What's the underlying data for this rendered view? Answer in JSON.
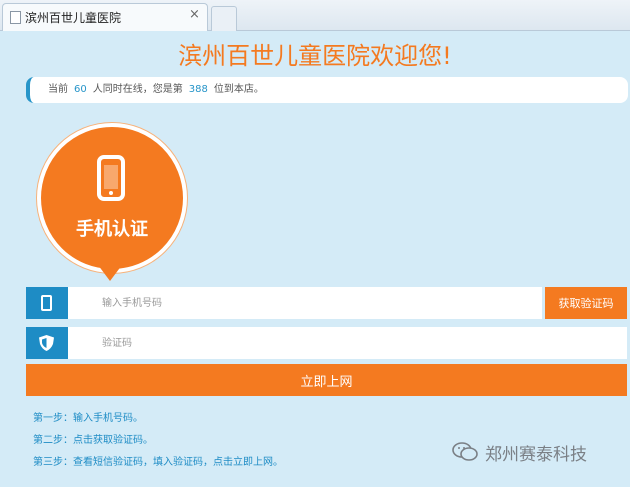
{
  "browser": {
    "tab_title": "滨州百世儿童医院",
    "tab_close": "×",
    "page_icon": "page-icon",
    "tab_close_icon": "close-icon"
  },
  "page": {
    "welcome": "滨州百世儿童医院欢迎您!",
    "online": {
      "prefix": "当前",
      "count": "60",
      "middle": "人同时在线，您是第",
      "rank": "388",
      "suffix": "位到本店。"
    },
    "auth_badge": {
      "label": "手机认证",
      "icon": "mobile-phone-icon"
    },
    "phone_field": {
      "placeholder": "输入手机号码",
      "icon": "mobile-phone-icon"
    },
    "get_code_button": "获取验证码",
    "code_field": {
      "placeholder": "验证码",
      "icon": "shield-icon"
    },
    "submit_button": "立即上网",
    "steps": [
      "第一步：输入手机号码。",
      "第二步：点击获取验证码。",
      "第三步：查看短信验证码，填入验证码，点击立即上网。"
    ],
    "watermark": {
      "text": "郑州赛泰科技",
      "icon": "wechat-icon"
    }
  },
  "colors": {
    "accent_orange": "#f47a20",
    "accent_blue": "#1e8cc5",
    "background": "#d4ebf7"
  }
}
